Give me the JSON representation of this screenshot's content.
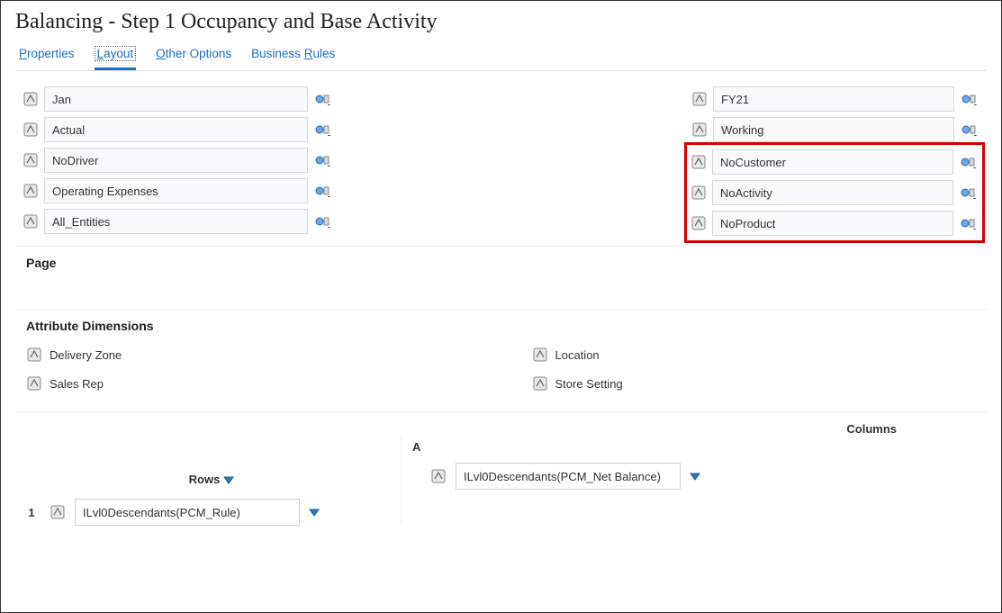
{
  "title": "Balancing - Step 1 Occupancy and Base Activity",
  "tabs": {
    "properties": "Properties",
    "layout": "Layout",
    "other": "Other Options",
    "rules": "Business Rules",
    "properties_u": "P",
    "layout_u": "L",
    "other_u": "O",
    "rules_u": "R"
  },
  "left_dims": [
    {
      "label": "Jan"
    },
    {
      "label": "Actual"
    },
    {
      "label": "NoDriver"
    },
    {
      "label": "Operating Expenses"
    },
    {
      "label": "All_Entities"
    }
  ],
  "right_dims": [
    {
      "label": "FY21",
      "hl": false
    },
    {
      "label": "Working",
      "hl": false
    },
    {
      "label": "NoCustomer",
      "hl": true
    },
    {
      "label": "NoActivity",
      "hl": true
    },
    {
      "label": "NoProduct",
      "hl": true
    }
  ],
  "sections": {
    "page": "Page",
    "attr": "Attribute Dimensions",
    "rows": "Rows",
    "columns": "Columns"
  },
  "attrs_left": [
    "Delivery Zone",
    "Sales Rep"
  ],
  "attrs_right": [
    "Location",
    "Store Setting"
  ],
  "grid": {
    "col_letter": "A",
    "col_value": "ILvl0Descendants(PCM_Net Balance)",
    "row_num": "1",
    "row_value": "ILvl0Descendants(PCM_Rule)"
  }
}
